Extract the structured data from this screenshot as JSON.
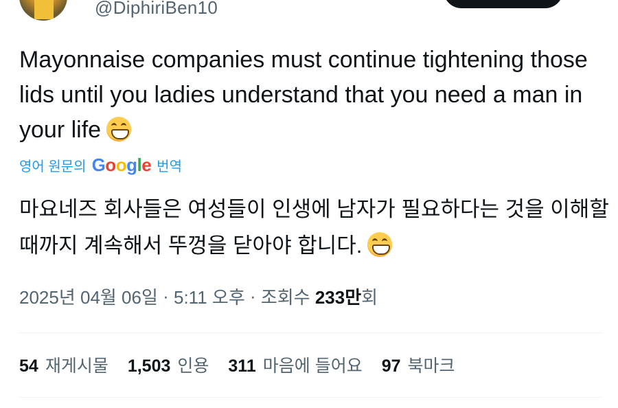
{
  "author": {
    "handle": "@DiphiriBen10"
  },
  "tweet": {
    "text": "Mayonnaise companies must continue tightening those lids until you ladies understand that you need a man in your life",
    "emoji": "grinning-face-with-smiling-eyes"
  },
  "translation": {
    "prefix": "영어 원문의",
    "google_logo": [
      "G",
      "o",
      "o",
      "g",
      "l",
      "e"
    ],
    "suffix": "번역",
    "text": "마요네즈 회사들은 여성들이 인생에 남자가 필요하다는 것을 이해할 때까지 계속해서 뚜껑을 닫아야 합니다."
  },
  "meta": {
    "date": "2025년 04월 06일",
    "sep1": " · ",
    "time": "5:11 오후",
    "sep2": " · ",
    "views_label": "조회수 ",
    "views_count": "233만",
    "views_suffix": "회"
  },
  "stats": [
    {
      "count": "54",
      "label": "재게시물"
    },
    {
      "count": "1,503",
      "label": "인용"
    },
    {
      "count": "311",
      "label": "마음에 들어요"
    },
    {
      "count": "97",
      "label": "북마크"
    }
  ],
  "colors": {
    "accent": "#1d9bf0",
    "secondary_text": "#536471",
    "primary_text": "#0f1419"
  }
}
